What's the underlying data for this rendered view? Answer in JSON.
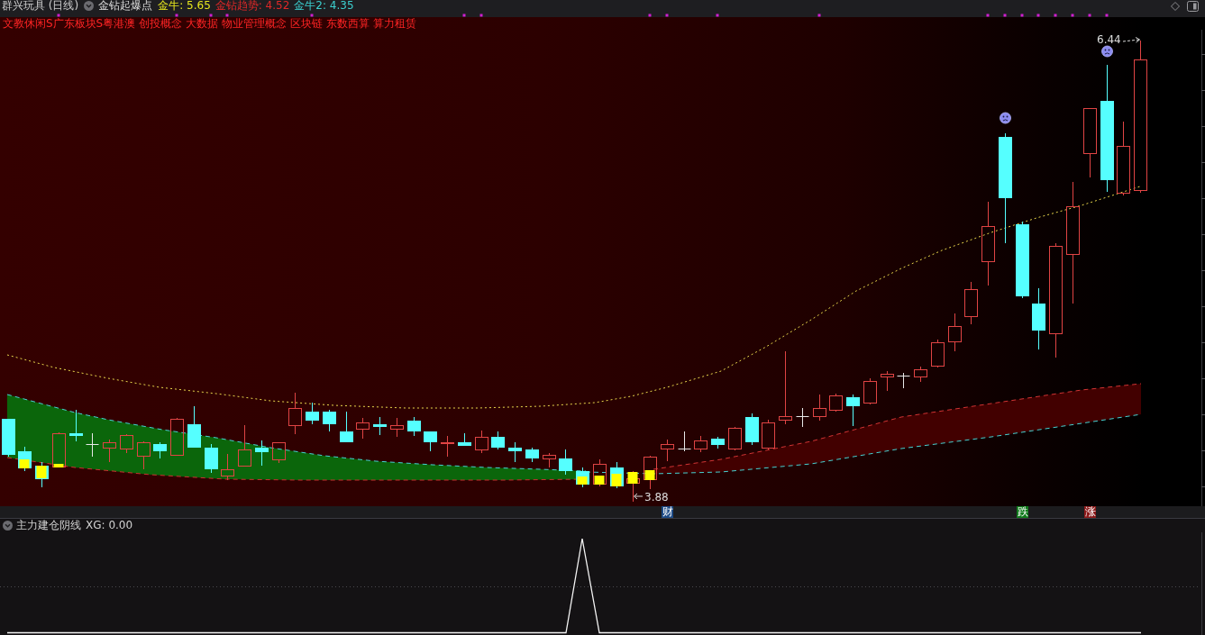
{
  "header": {
    "title": "群兴玩具 (日线)",
    "indicator": "金钻起爆点",
    "values": [
      {
        "label": "金牛: 5.65",
        "color": "#e6e61e"
      },
      {
        "label": "金钻趋势: 4.52",
        "color": "#e02828"
      },
      {
        "label": "金牛2: 4.35",
        "color": "#3ccfcf"
      }
    ]
  },
  "concept_tags": [
    "文教休闲S广东板块S粤港澳",
    "创投概念",
    "大数据",
    "物业管理概念",
    "区块链",
    "东数西算",
    "算力租赁"
  ],
  "price_chart": {
    "high_label": "6.44",
    "low_label": "3.88"
  },
  "event_markers": [
    {
      "label": "财",
      "color": "#1d4a85"
    },
    {
      "label": "跌",
      "color": "#0f7a1a"
    },
    {
      "label": "涨",
      "color": "#8b1a1a"
    }
  ],
  "sub_panel": {
    "title": "主力建仓阴线",
    "reading": "XG: 0.00"
  }
}
